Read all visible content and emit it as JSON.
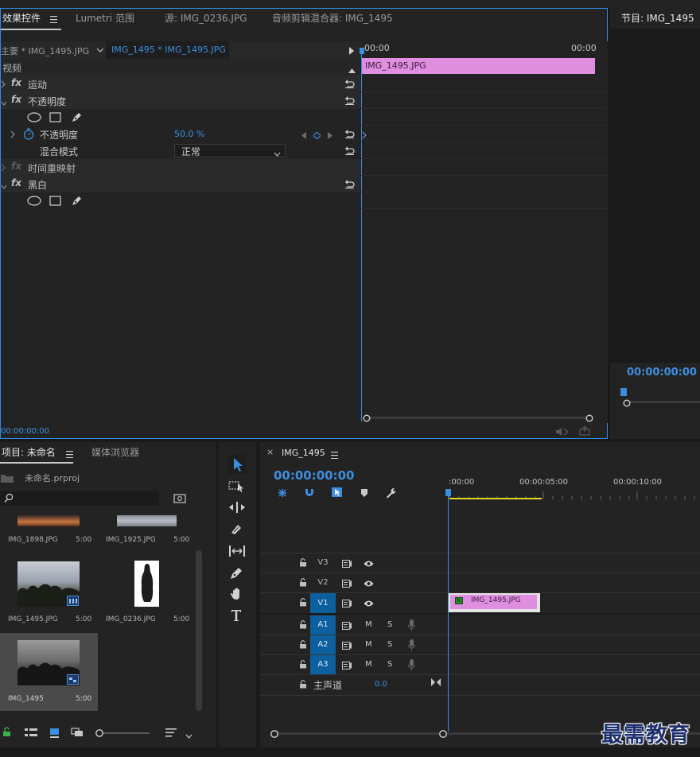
{
  "effect_controls": {
    "tabs": [
      {
        "label": "效果控件",
        "active": true
      },
      {
        "label": "Lumetri 范围"
      },
      {
        "label": "源: IMG_0236.JPG"
      },
      {
        "label": "音频剪辑混合器: IMG_1495"
      }
    ],
    "master_label": "主要 * IMG_1495.JPG",
    "clip_label": "IMG_1495 * IMG_1495.JPG",
    "ruler_start": "00:00",
    "ruler_end": "00:00",
    "clip_bar": "IMG_1495.JPG",
    "section_video": "视频",
    "motion": "运动",
    "opacity": "不透明度",
    "opacity_param": "不透明度",
    "opacity_value": "50.0 %",
    "blend_mode_label": "混合模式",
    "blend_mode_value": "正常",
    "time_remap": "时间重映射",
    "black_white": "黑白",
    "fx": "fx",
    "timecode": "00:00:00:00"
  },
  "program": {
    "title": "节目: IMG_1495",
    "timecode": "00:00:00:00"
  },
  "project": {
    "tabs": [
      {
        "label": "项目: 未命名",
        "active": true
      },
      {
        "label": "媒体浏览器"
      }
    ],
    "file": "未命名.prproj",
    "search_placeholder": "",
    "items": [
      {
        "name": "IMG_1898.JPG",
        "duration": "5:00"
      },
      {
        "name": "IMG_1925.JPG",
        "duration": "5:00"
      },
      {
        "name": "IMG_1495.JPG",
        "duration": "5:00"
      },
      {
        "name": "IMG_0236.JPG",
        "duration": "5:00"
      },
      {
        "name": "IMG_1495",
        "duration": "5:00"
      }
    ]
  },
  "timeline": {
    "close": "×",
    "title": "IMG_1495",
    "timecode": "00:00:00:00",
    "ruler": [
      ":00:00",
      "00:00:05:00",
      "00:00:10:00"
    ],
    "tracks": {
      "v3": "V3",
      "v2": "V2",
      "v1": "V1",
      "a1": "A1",
      "a2": "A2",
      "a3": "A3",
      "m": "M",
      "s": "S"
    },
    "clip": "IMG_1495.JPG",
    "clip_fx": "fx",
    "master": "主声道",
    "master_value": "0.0"
  },
  "watermark": "最需教育"
}
